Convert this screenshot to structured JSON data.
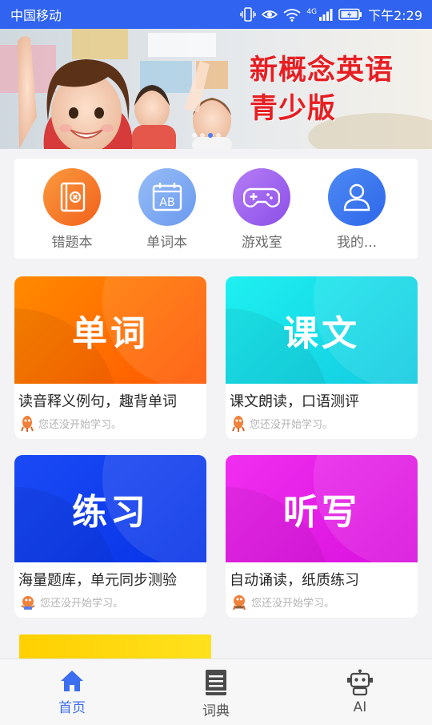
{
  "status_bar": {
    "carrier": "中国移动",
    "network": "4G",
    "time": "下午2:29"
  },
  "banner": {
    "title_line1": "新概念英语",
    "title_line2": "青少版",
    "slide_count": 4,
    "active_slide": 3
  },
  "quick_actions": [
    {
      "label": "错题本",
      "icon": "wrong-book-icon",
      "color": "#f67a26"
    },
    {
      "label": "单词本",
      "icon": "word-calendar-icon",
      "color": "#78a6f2"
    },
    {
      "label": "游戏室",
      "icon": "gamepad-icon",
      "color": "#a064f0"
    },
    {
      "label": "我的...",
      "icon": "user-icon",
      "color": "#3f7bf1"
    }
  ],
  "cards": [
    {
      "title": "单词",
      "desc": "读音释义例句，趣背单词",
      "status": "您还没开始学习。",
      "color": "#ff6e00"
    },
    {
      "title": "课文",
      "desc": "课文朗读，口语测评",
      "status": "您还没开始学习。",
      "color": "#16dce8"
    },
    {
      "title": "练习",
      "desc": "海量题库，单元同步测验",
      "status": "您还没开始学习。",
      "color": "#0a3cf0"
    },
    {
      "title": "听写",
      "desc": "自动诵读，纸质练习",
      "status": "您还没开始学习。",
      "color": "#e61ee6"
    }
  ],
  "tabs": [
    {
      "label": "首页",
      "icon": "home-icon",
      "active": true
    },
    {
      "label": "词典",
      "icon": "dictionary-icon",
      "active": false
    },
    {
      "label": "AI",
      "icon": "robot-icon",
      "active": false
    }
  ],
  "colors": {
    "status_bar": "#2f63f0",
    "active_tab": "#3c6ef0"
  }
}
